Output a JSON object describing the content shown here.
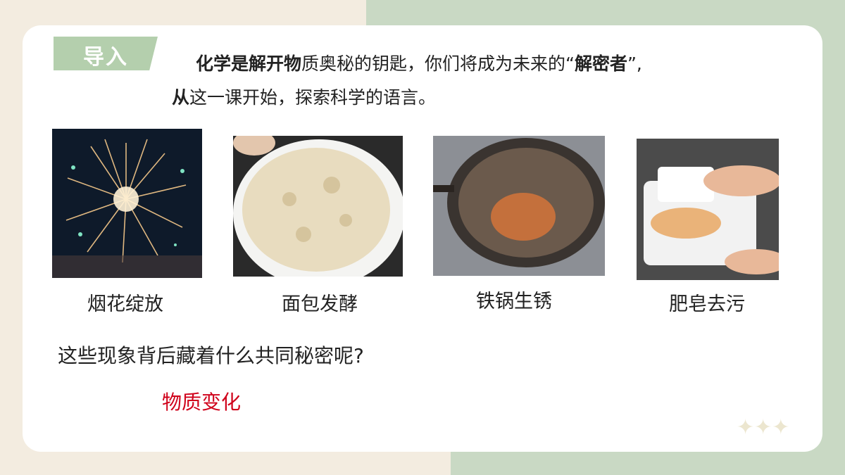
{
  "tag": {
    "label": "导入"
  },
  "intro": {
    "line1_bold": "化学是解开物",
    "line1_rest": "质奥秘的钥匙，你们将成为未来的“",
    "line1_bold2": "解密者",
    "line1_end": "”,",
    "line2_bold": "从",
    "line2_rest": "这一课开始，探索科学的语言。"
  },
  "examples": [
    {
      "caption": "烟花绽放",
      "image": "fireworks"
    },
    {
      "caption": "面包发酵",
      "image": "bread-dough"
    },
    {
      "caption": "铁锅生锈",
      "image": "rusty-wok"
    },
    {
      "caption": "肥皂去污",
      "image": "soap-cleaning"
    }
  ],
  "question": "这些现象背后藏着什么共同秘密呢?",
  "answer": "物质变化",
  "decor": {
    "stars": "✦✦✦"
  },
  "colors": {
    "tag_bg": "#b4cfad",
    "answer": "#d0021b",
    "accent_green": "#c9d9c4"
  }
}
